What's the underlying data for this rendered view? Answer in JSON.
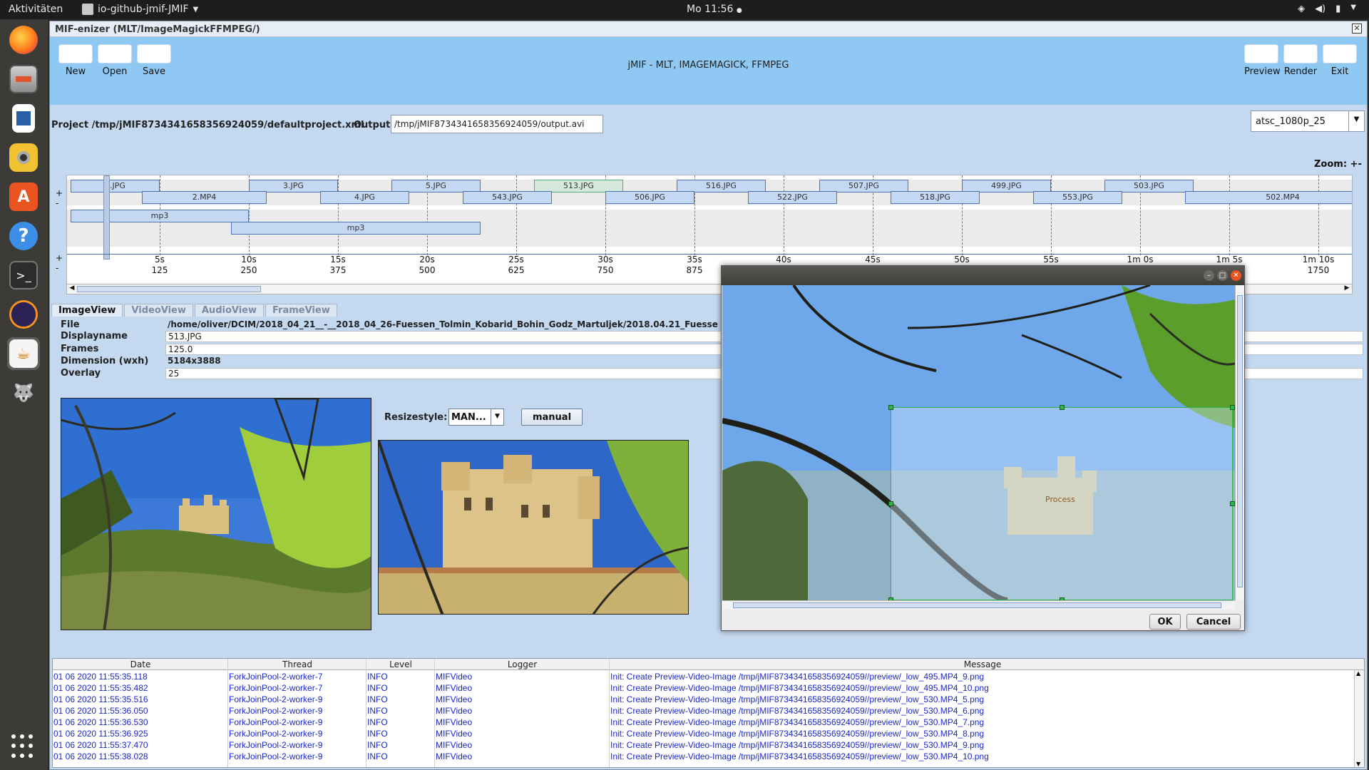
{
  "topbar": {
    "activities": "Aktivitäten",
    "app_name": "io-github-jmif-JMIF",
    "clock": "Mo 11:56"
  },
  "dock": {
    "items": [
      "firefox-icon",
      "files-icon",
      "writer-icon",
      "rhythmbox-icon",
      "software-icon",
      "help-icon",
      "terminal-icon",
      "eclipse-icon",
      "java-icon",
      "gimp-icon"
    ]
  },
  "window": {
    "title": "MIF-enizer (MLT/ImageMagickFFMPEG/)",
    "close_label": "✕"
  },
  "toolbar": {
    "new_label": "New",
    "open_label": "Open",
    "save_label": "Save",
    "heading": "jMIF - MLT, IMAGEMAGICK, FFMPEG",
    "preview_label": "Preview",
    "render_label": "Render",
    "exit_label": "Exit"
  },
  "project": {
    "project_label": "Project /tmp/jMIF8734341658356924059/defaultproject.xml",
    "output_label": "Output",
    "output_value": "/tmp/jMIF8734341658356924059/output.avi",
    "format": "atsc_1080p_25",
    "zoom_label": "Zoom: +-"
  },
  "timeline": {
    "video_row1": [
      {
        "label": "1.JPG",
        "start": 0.0,
        "end": 5.0
      },
      {
        "label": "3.JPG",
        "start": 10.0,
        "end": 15.0
      },
      {
        "label": "5.JPG",
        "start": 18.0,
        "end": 23.0
      },
      {
        "label": "513.JPG",
        "start": 26.0,
        "end": 31.0,
        "selected": true
      },
      {
        "label": "516.JPG",
        "start": 34.0,
        "end": 39.0
      },
      {
        "label": "507.JPG",
        "start": 42.0,
        "end": 47.0
      },
      {
        "label": "499.JPG",
        "start": 50.0,
        "end": 55.0
      },
      {
        "label": "503.JPG",
        "start": 58.0,
        "end": 63.0
      }
    ],
    "video_row2": [
      {
        "label": "2.MP4",
        "start": 4.0,
        "end": 11.0
      },
      {
        "label": "4.JPG",
        "start": 14.0,
        "end": 19.0
      },
      {
        "label": "543.JPG",
        "start": 22.0,
        "end": 27.0
      },
      {
        "label": "506.JPG",
        "start": 30.0,
        "end": 35.0
      },
      {
        "label": "522.JPG",
        "start": 38.0,
        "end": 43.0
      },
      {
        "label": "518.JPG",
        "start": 46.0,
        "end": 51.0
      },
      {
        "label": "553.JPG",
        "start": 54.0,
        "end": 59.0
      },
      {
        "label": "502.MP4",
        "start": 62.5,
        "end": 73.5
      }
    ],
    "audio_row1": [
      {
        "label": "mp3",
        "start": 0.0,
        "end": 10.0
      }
    ],
    "audio_row2": [
      {
        "label": "mp3",
        "start": 9.0,
        "end": 23.0
      }
    ],
    "seconds": [
      "5s",
      "10s",
      "15s",
      "20s",
      "25s",
      "30s",
      "35s",
      "40s",
      "45s",
      "50s",
      "55s",
      "1m 0s",
      "1m 5s",
      "1m 10s"
    ],
    "frames": [
      "125",
      "250",
      "375",
      "500",
      "625",
      "750",
      "875",
      "1000",
      "1125",
      "1250",
      "1375",
      "1500",
      "1625",
      "1750"
    ]
  },
  "tabs": [
    "ImageView",
    "VideoView",
    "AudioView",
    "FrameView"
  ],
  "props": {
    "file_label": "File",
    "file_value": "/home/oliver/DCIM/2018_04_21__-__2018_04_26-Fuessen_Tolmin_Kobarid_Bohin_Godz_Martuljek/2018.04.21_Fuesse",
    "displayname_label": "Displayname",
    "displayname_value": "513.JPG",
    "frames_label": "Frames",
    "frames_value": "125.0",
    "dimension_label": "Dimension (wxh)",
    "dimension_value": "5184x3888",
    "overlay_label": "Overlay",
    "overlay_value": "25"
  },
  "resize": {
    "label": "Resizestyle:",
    "value": "MAN...",
    "manual_label": "manual"
  },
  "dialog": {
    "ok_label": "OK",
    "cancel_label": "Cancel",
    "crop_label": "Process"
  },
  "log": {
    "columns": [
      "Date",
      "Thread",
      "Level",
      "Logger",
      "Message"
    ],
    "rows": [
      [
        "01 06 2020 11:55:35.118",
        "ForkJoinPool-2-worker-7",
        "INFO",
        "MIFVideo",
        "Init: Create Preview-Video-Image /tmp/jMIF8734341658356924059//preview/_low_495.MP4_9.png"
      ],
      [
        "01 06 2020 11:55:35.482",
        "ForkJoinPool-2-worker-7",
        "INFO",
        "MIFVideo",
        "Init: Create Preview-Video-Image /tmp/jMIF8734341658356924059//preview/_low_495.MP4_10.png"
      ],
      [
        "01 06 2020 11:55:35.516",
        "ForkJoinPool-2-worker-9",
        "INFO",
        "MIFVideo",
        "Init: Create Preview-Video-Image /tmp/jMIF8734341658356924059//preview/_low_530.MP4_5.png"
      ],
      [
        "01 06 2020 11:55:36.050",
        "ForkJoinPool-2-worker-9",
        "INFO",
        "MIFVideo",
        "Init: Create Preview-Video-Image /tmp/jMIF8734341658356924059//preview/_low_530.MP4_6.png"
      ],
      [
        "01 06 2020 11:55:36.530",
        "ForkJoinPool-2-worker-9",
        "INFO",
        "MIFVideo",
        "Init: Create Preview-Video-Image /tmp/jMIF8734341658356924059//preview/_low_530.MP4_7.png"
      ],
      [
        "01 06 2020 11:55:36.925",
        "ForkJoinPool-2-worker-9",
        "INFO",
        "MIFVideo",
        "Init: Create Preview-Video-Image /tmp/jMIF8734341658356924059//preview/_low_530.MP4_8.png"
      ],
      [
        "01 06 2020 11:55:37.470",
        "ForkJoinPool-2-worker-9",
        "INFO",
        "MIFVideo",
        "Init: Create Preview-Video-Image /tmp/jMIF8734341658356924059//preview/_low_530.MP4_9.png"
      ],
      [
        "01 06 2020 11:55:38.028",
        "ForkJoinPool-2-worker-9",
        "INFO",
        "MIFVideo",
        "Init: Create Preview-Video-Image /tmp/jMIF8734341658356924059//preview/_low_530.MP4_10.png"
      ]
    ]
  }
}
